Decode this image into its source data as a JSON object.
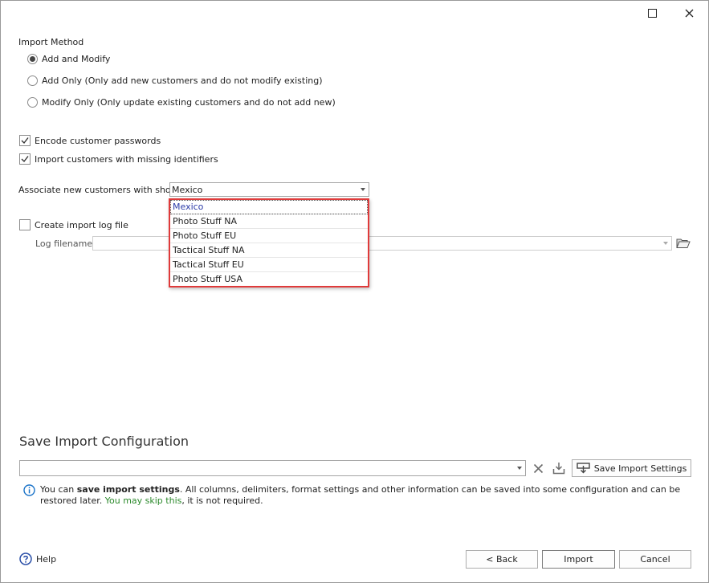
{
  "window": {
    "icons": {
      "maximize": "maximize-icon",
      "close": "close-icon"
    }
  },
  "import_method": {
    "label": "Import Method",
    "options": [
      {
        "label": "Add and Modify",
        "selected": true
      },
      {
        "label": "Add Only (Only add new customers and do not modify existing)",
        "selected": false
      },
      {
        "label": "Modify Only (Only update existing customers and do not add new)",
        "selected": false
      }
    ]
  },
  "options": {
    "encode_passwords": {
      "label": "Encode customer passwords",
      "checked": true
    },
    "import_missing_identifiers": {
      "label": "Import customers with missing identifiers",
      "checked": true
    }
  },
  "shop": {
    "label": "Associate new customers with shop",
    "selected": "Mexico",
    "dropdown_items": [
      "Mexico",
      "Photo Stuff NA",
      "Photo Stuff EU",
      "Tactical Stuff NA",
      "Tactical Stuff EU",
      "Photo Stuff USA"
    ]
  },
  "log": {
    "create_label": "Create import log file",
    "create_checked": false,
    "filename_label": "Log filename",
    "filename_value": ""
  },
  "save_config": {
    "title": "Save Import Configuration",
    "value": "",
    "save_button": "Save Import Settings",
    "info": {
      "part1": "You can ",
      "bold": "save import settings",
      "part2": ". All columns, delimiters, format settings and other information can be saved into some configuration and can be restored later. ",
      "green1": "You may skip this",
      "part3": ", it is not required."
    }
  },
  "footer": {
    "help": "Help",
    "back": "< Back",
    "import": "Import",
    "cancel": "Cancel"
  },
  "colors": {
    "highlight_border": "#e03a3a",
    "info_blue": "#1a73c8",
    "green_text": "#2c8a2c"
  }
}
